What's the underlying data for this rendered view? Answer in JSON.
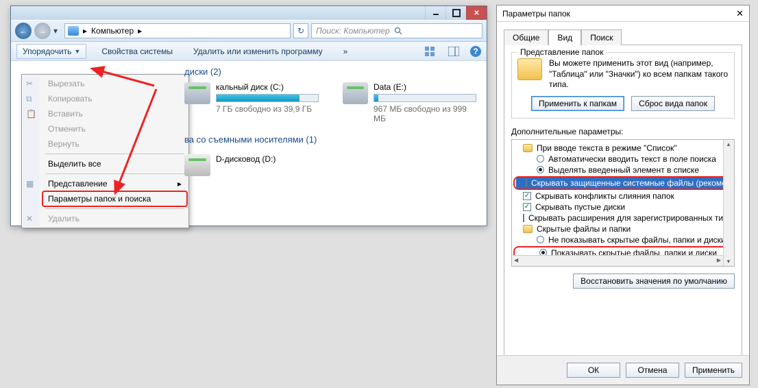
{
  "explorer": {
    "breadcrumb": "Компьютер",
    "breadcrumb_sep": "▸",
    "search_placeholder": "Поиск: Компьютер",
    "toolbar": {
      "organize": "Упорядочить",
      "props": "Свойства системы",
      "uninstall": "Удалить или изменить программу",
      "more": "»"
    },
    "menu": {
      "cut": "Вырезать",
      "copy": "Копировать",
      "paste": "Вставить",
      "undo": "Отменить",
      "redo": "Вернуть",
      "select_all": "Выделить все",
      "layout": "Представление",
      "folder_options": "Параметры папок и поиска",
      "delete": "Удалить"
    },
    "section_drives": "диски (2)",
    "section_removable": "ва со съемными носителями (1)",
    "drives": [
      {
        "name": "кальный диск (C:)",
        "free": "7 ГБ свободно из 39,9 ГБ",
        "fill": 82
      },
      {
        "name": "Data (E:)",
        "free": "967 МБ свободно из 999 МБ",
        "fill": 4
      }
    ],
    "dvd": "D-дисковод (D:)"
  },
  "dialog": {
    "title": "Параметры папок",
    "tabs": {
      "general": "Общие",
      "view": "Вид",
      "search": "Поиск"
    },
    "group_title": "Представление папок",
    "group_text": "Вы можете применить этот вид (например, \"Таблица\" или \"Значки\") ко всем папкам такого типа.",
    "apply_folders": "Применить к папкам",
    "reset_folders": "Сброс вида папок",
    "adv_label": "Дополнительные параметры:",
    "tree": {
      "n1": "При вводе текста в режиме \"Список\"",
      "n1a": "Автоматически вводить текст в поле поиска",
      "n1b": "Выделять введенный элемент в списке",
      "n2": "Скрывать защищенные системные файлы (рекомен…",
      "n3": "Скрывать конфликты слияния папок",
      "n4": "Скрывать пустые диски",
      "n5": "Скрывать расширения для зарегистрированных типо",
      "n6": "Скрытые файлы и папки",
      "n6a": "Не показывать скрытые файлы, папки и диски",
      "n6b": "Показывать скрытые файлы, папки и диски"
    },
    "restore": "Восстановить значения по умолчанию",
    "ok": "ОК",
    "cancel": "Отмена",
    "apply": "Применить"
  }
}
